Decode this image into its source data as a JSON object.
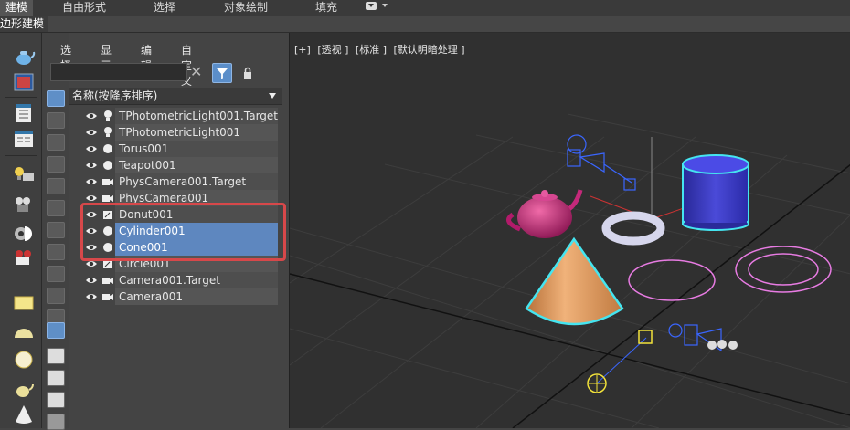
{
  "ribbon": {
    "tabs": [
      "建模",
      "自由形式",
      "选择",
      "对象绘制",
      "填充"
    ],
    "panel_title": "边形建模"
  },
  "scene_explorer": {
    "menu": [
      "选择",
      "显示",
      "编辑",
      "自定义"
    ],
    "search": {
      "value": "",
      "placeholder": ""
    },
    "column_header": "名称(按降序排序)",
    "rows": [
      {
        "name": "TPhotometricLight001.Target",
        "type_icon": "light-icon",
        "selected": false
      },
      {
        "name": "TPhotometricLight001",
        "type_icon": "light-icon",
        "selected": false
      },
      {
        "name": "Torus001",
        "type_icon": "geometry-icon",
        "selected": false
      },
      {
        "name": "Teapot001",
        "type_icon": "geometry-icon",
        "selected": false
      },
      {
        "name": "PhysCamera001.Target",
        "type_icon": "camera-icon",
        "selected": false
      },
      {
        "name": "PhysCamera001",
        "type_icon": "camera-icon",
        "selected": false
      },
      {
        "name": "Donut001",
        "type_icon": "shape-icon",
        "selected": false
      },
      {
        "name": "Cylinder001",
        "type_icon": "geometry-icon",
        "selected": true
      },
      {
        "name": "Cone001",
        "type_icon": "geometry-icon",
        "selected": true
      },
      {
        "name": "Circle001",
        "type_icon": "shape-icon",
        "selected": false
      },
      {
        "name": "Camera001.Target",
        "type_icon": "camera-icon",
        "selected": false
      },
      {
        "name": "Camera001",
        "type_icon": "camera-icon",
        "selected": false
      }
    ]
  },
  "viewport": {
    "labels": [
      "[+]",
      "[透视 ]",
      "[标准 ]",
      "[默认明暗处理 ]"
    ]
  },
  "colors": {
    "selection_blue": "#5e87bf",
    "highlight_red": "#d7484a",
    "cone": "#d9965a",
    "cylinder": "#3e3ec8",
    "teapot": "#c5297a",
    "selection_outline": "#45e5f0"
  }
}
